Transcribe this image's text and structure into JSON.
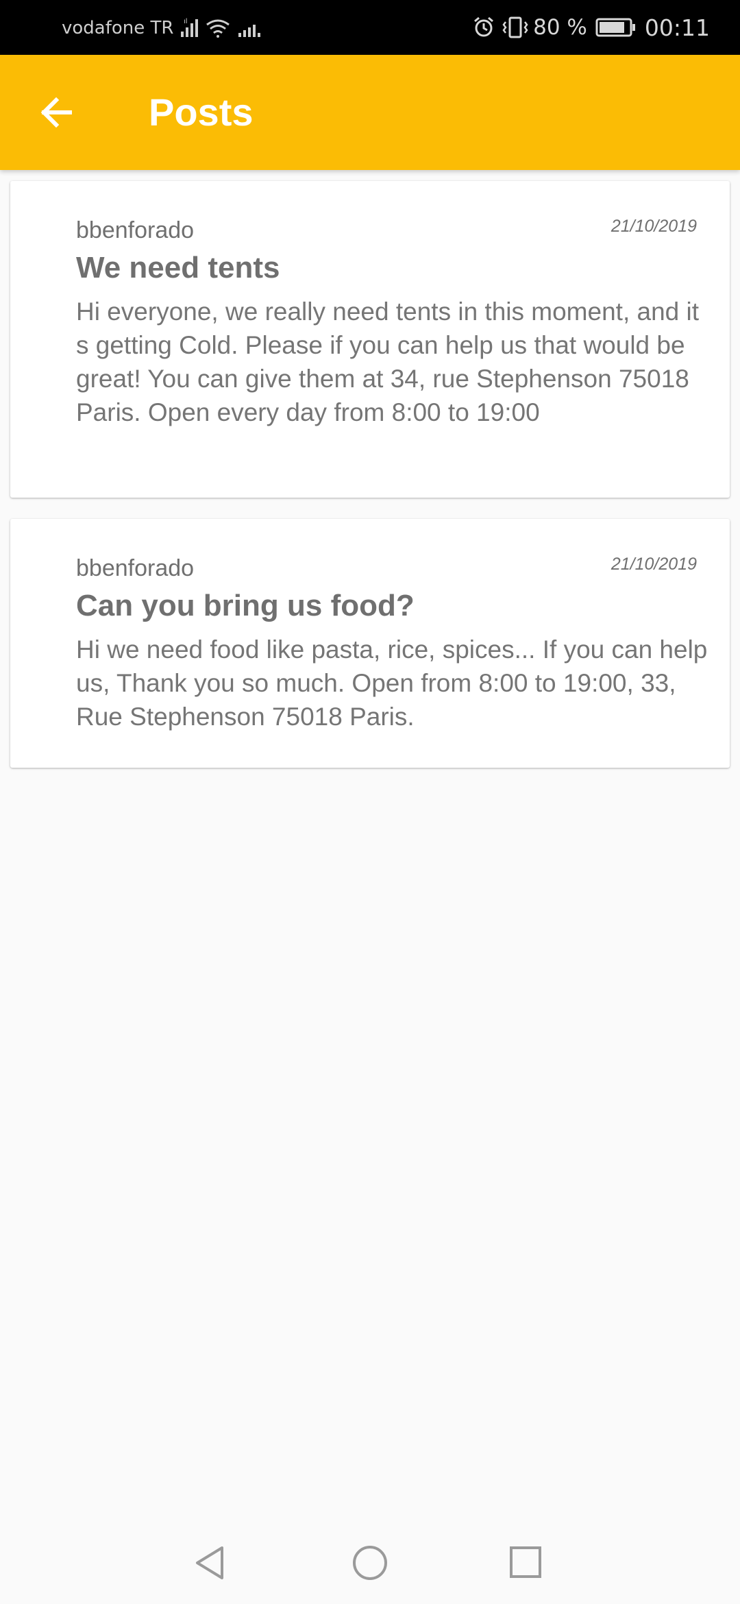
{
  "status_bar": {
    "carrier": "vodafone TR",
    "battery_percent": "80 %",
    "time": "00:11"
  },
  "app_bar": {
    "title": "Posts"
  },
  "posts": [
    {
      "author": "bbenforado",
      "date": "21/10/2019",
      "title": "We need tents",
      "body": "Hi everyone, we really need tents in this moment, and it s getting Cold. Please if you can help us that would be great! You can give them at 34, rue Stephenson 75018 Paris. Open every day from 8:00 to 19:00"
    },
    {
      "author": "bbenforado",
      "date": "21/10/2019",
      "title": "Can you bring us food?",
      "body": "Hi we need food like pasta, rice, spices... If you can help us, Thank you so much. Open from 8:00 to 19:00, 33, Rue Stephenson 75018 Paris."
    }
  ],
  "icons": {
    "back": "arrow-left-icon",
    "signal": "signal-icon",
    "wifi": "wifi-icon",
    "alarm": "alarm-icon",
    "vibrate": "vibrate-icon",
    "battery": "battery-icon",
    "nav_back": "nav-back-icon",
    "nav_home": "nav-home-icon",
    "nav_recents": "nav-recents-icon"
  },
  "colors": {
    "app_bar": "#fbbc05",
    "background": "#fafafa",
    "text": "#757575"
  }
}
